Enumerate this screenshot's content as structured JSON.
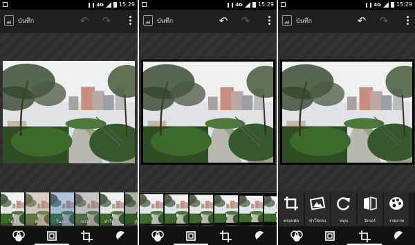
{
  "status_bar": {
    "network": "4G",
    "time": "15:29"
  },
  "app_bar": {
    "title": "บันทึก"
  },
  "panels": [
    {
      "mode": "filters",
      "undo_enabled": false,
      "thumbnails": [
        {
          "label": "ไม่มี",
          "selected": true
        },
        {
          "label": "พัง",
          "selected": false
        },
        {
          "label": "ในแสง",
          "selected": false
        },
        {
          "label": "ขาวดำ",
          "selected": false
        },
        {
          "label": "ทำให้ชัด",
          "selected": false
        },
        {
          "label": "รูปเ",
          "selected": false
        }
      ]
    },
    {
      "mode": "frames",
      "undo_enabled": true,
      "thumbnails": [
        {
          "label": "",
          "selected": false
        },
        {
          "label": "",
          "selected": false
        },
        {
          "label": "",
          "selected": false
        },
        {
          "label": "",
          "selected": true
        },
        {
          "label": "",
          "selected": false
        },
        {
          "label": "",
          "selected": false
        }
      ]
    },
    {
      "mode": "tools",
      "undo_enabled": true,
      "tools": [
        {
          "label": "ครอบตัด",
          "icon": "crop-icon"
        },
        {
          "label": "ทำให้ตรง",
          "icon": "straighten-icon"
        },
        {
          "label": "หมุน",
          "icon": "rotate-icon"
        },
        {
          "label": "มิเรอร์",
          "icon": "mirror-icon"
        },
        {
          "label": "วาดภาพ",
          "icon": "paint-icon"
        }
      ]
    }
  ],
  "nav": {
    "items": [
      "filters-icon",
      "frames-icon",
      "crop-icon",
      "adjust-icon"
    ],
    "active_index": [
      1,
      1,
      2
    ]
  },
  "colors": {
    "accent": "#ffffff",
    "background": "#2b2b2b",
    "bar": "#1f1f1f"
  }
}
